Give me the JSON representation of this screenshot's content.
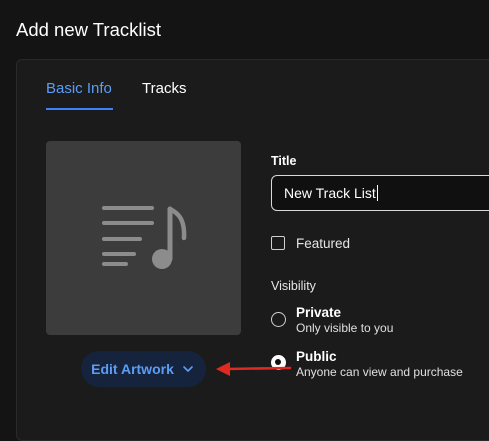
{
  "page": {
    "title": "Add new Tracklist"
  },
  "tabs": [
    {
      "label": "Basic Info",
      "active": true
    },
    {
      "label": "Tracks",
      "active": false
    }
  ],
  "artwork": {
    "icon": "music-list-icon",
    "edit_label": "Edit Artwork"
  },
  "form": {
    "title_label": "Title",
    "title_value": "New Track List",
    "featured_label": "Featured",
    "featured_checked": false,
    "visibility_label": "Visibility",
    "options": [
      {
        "title": "Private",
        "desc": "Only visible to you",
        "selected": false
      },
      {
        "title": "Public",
        "desc": "Anyone can view and purchase",
        "selected": true
      }
    ]
  },
  "colors": {
    "accent": "#3b82f6",
    "annotation_arrow": "#e02a1f"
  }
}
